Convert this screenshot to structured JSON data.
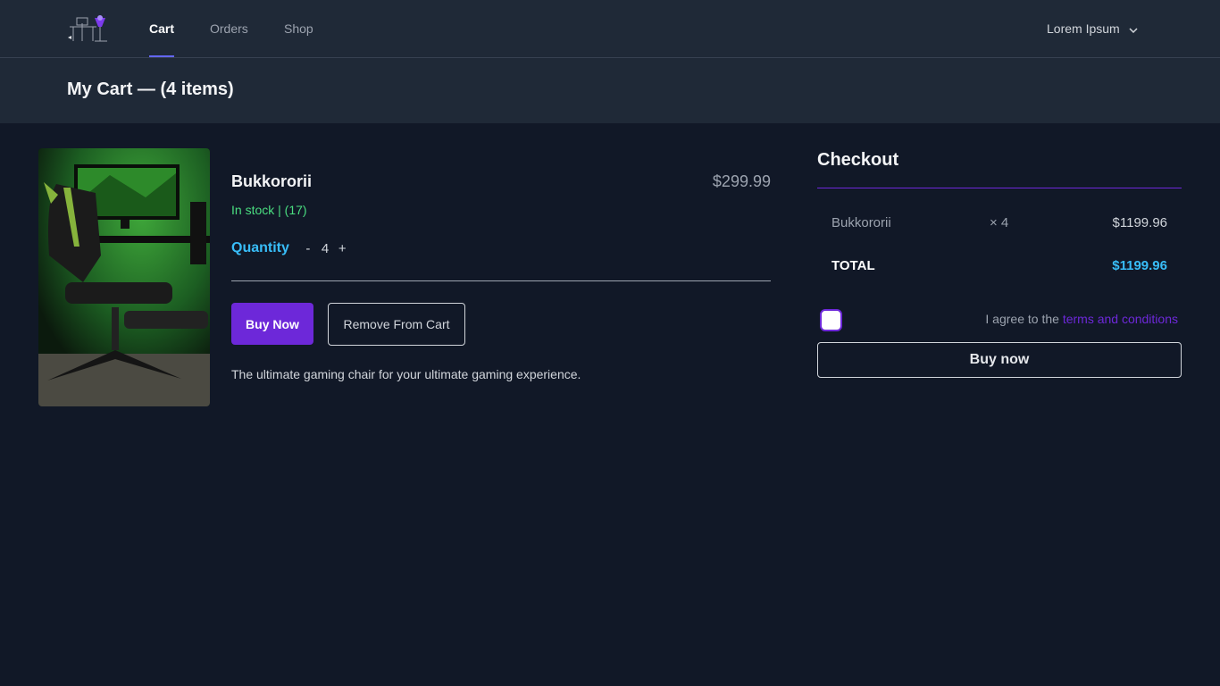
{
  "nav": {
    "links": [
      {
        "label": "Cart",
        "active": true
      },
      {
        "label": "Orders",
        "active": false
      },
      {
        "label": "Shop",
        "active": false
      }
    ],
    "user": {
      "name": "Lorem Ipsum",
      "icon": "chevron-down-icon"
    }
  },
  "page": {
    "title": "My Cart — (4 items)"
  },
  "cart": {
    "item": {
      "name": "Bukkororii",
      "price": "$299.99",
      "stock": "In stock | (17)",
      "quantity_label": "Quantity",
      "quantity_minus": "-",
      "quantity": "4",
      "quantity_plus": "+",
      "buy_now_label": "Buy Now",
      "remove_label": "Remove From Cart",
      "description": "The ultimate gaming chair for your ultimate gaming experience."
    }
  },
  "checkout": {
    "title": "Checkout",
    "line_item": {
      "name": "Bukkororii",
      "qty": "× 4",
      "price": "$1199.96"
    },
    "total_label": "TOTAL",
    "total_value": "$1199.96",
    "agree_text": "I agree to the ",
    "terms_link": "terms and conditions",
    "buy_now_label": "Buy now"
  },
  "colors": {
    "background": "#111827",
    "nav": "#1f2937",
    "accent": "#6d28d9",
    "in_stock": "#4ade80",
    "highlight": "#38bdf8"
  }
}
